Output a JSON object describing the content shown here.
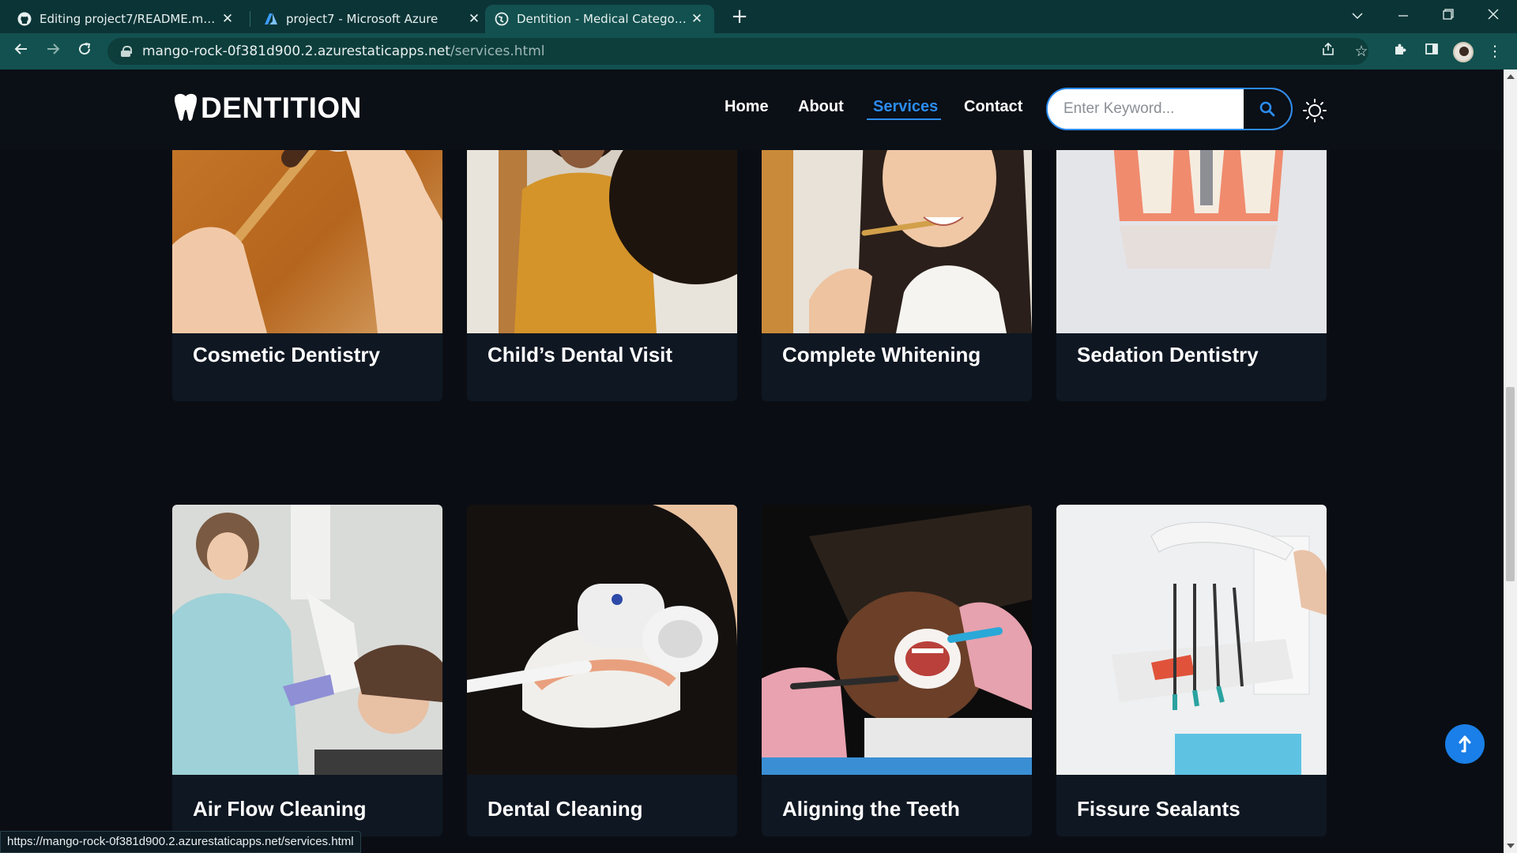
{
  "browser": {
    "tabs": [
      {
        "title": "Editing project7/README.md at main",
        "icon": "github-icon"
      },
      {
        "title": "project7 - Microsoft Azure",
        "icon": "azure-icon"
      },
      {
        "title": "Dentition - Medical Category Bootstrap",
        "icon": "globe-icon",
        "active": true
      }
    ],
    "url_host": "mango-rock-0f381d900.2.azurestaticapps.net",
    "url_path": "/services.html",
    "status_url": "https://mango-rock-0f381d900.2.azurestaticapps.net/services.html"
  },
  "site": {
    "brand": "DENTITION",
    "nav": [
      {
        "label": "Home"
      },
      {
        "label": "About"
      },
      {
        "label": "Services",
        "active": true
      },
      {
        "label": "Contact"
      }
    ],
    "search_placeholder": "Enter Keyword...",
    "accent": "#2b8cf0"
  },
  "services": [
    {
      "title": "Cosmetic Dentistry",
      "image": "toothbrush-tablets-photo"
    },
    {
      "title": "Child’s Dental Visit",
      "image": "child-brushing-photo"
    },
    {
      "title": "Complete Whitening",
      "image": "woman-brushing-photo"
    },
    {
      "title": "Sedation Dentistry",
      "image": "tooth-implant-model-photo"
    },
    {
      "title": "Air Flow Cleaning",
      "image": "dentist-xray-photo"
    },
    {
      "title": "Dental Cleaning",
      "image": "dental-model-brush-photo"
    },
    {
      "title": "Aligning the Teeth",
      "image": "patient-retractor-photo"
    },
    {
      "title": "Fissure Sealants",
      "image": "dental-chair-tools-photo"
    }
  ]
}
